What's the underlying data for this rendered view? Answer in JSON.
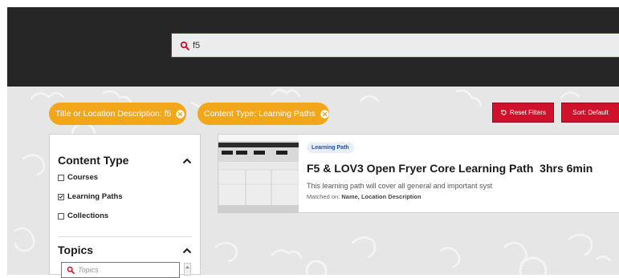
{
  "search": {
    "value": "f5"
  },
  "filters": {
    "chips": [
      {
        "label": "Title or Location Description: f5"
      },
      {
        "label": "Content Type: Learning Paths"
      }
    ],
    "reset_label": "Reset Filters",
    "sort_label": "Sort: Default"
  },
  "sidebar": {
    "content_type": {
      "title": "Content Type",
      "options": [
        {
          "label": "Courses",
          "checked": false
        },
        {
          "label": "Learning Paths",
          "checked": true
        },
        {
          "label": "Collections",
          "checked": false
        }
      ]
    },
    "topics": {
      "title": "Topics",
      "placeholder": "Topics"
    }
  },
  "results": [
    {
      "badge": "Learning Path",
      "title": "F5 & LOV3 Open Fryer Core Learning Path  3hrs 6min",
      "description": "This learning path will cover all general and important syst",
      "matched_prefix": "Matched on:",
      "matched_fields": "Name, Location Description"
    }
  ],
  "colors": {
    "header_bg": "#262626",
    "accent_red": "#c8102e",
    "chip_orange": "#f2a71b",
    "badge_blue": "#1f4e99"
  }
}
